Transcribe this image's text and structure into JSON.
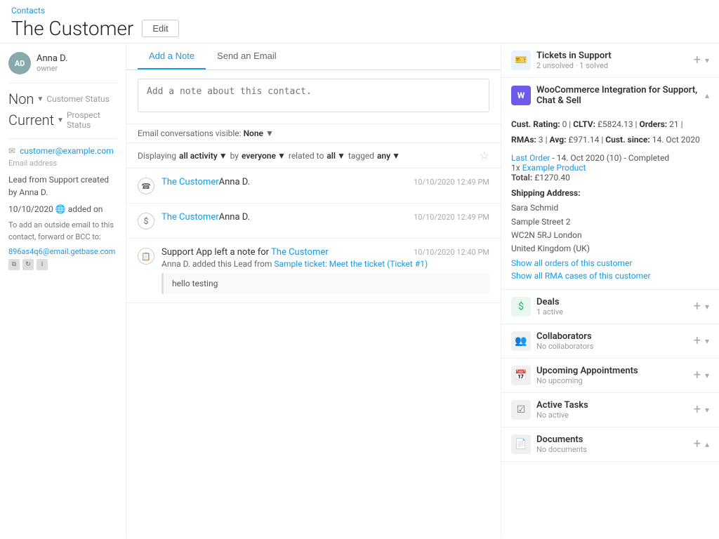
{
  "breadcrumb": "Contacts",
  "page_title": "The Customer",
  "edit_button": "Edit",
  "owner": {
    "initials": "AD",
    "name": "Anna D.",
    "role": "owner"
  },
  "status": {
    "non_label": "Non",
    "customer_status": "Customer Status",
    "current_label": "Current",
    "prospect_status": "Prospect Status"
  },
  "email": {
    "value": "customer@example.com",
    "label": "Email address"
  },
  "lead_info": "Lead from Support created by Anna D.",
  "date_added": "10/10/2020",
  "date_added_suffix": "added on",
  "bcc_info": "To add an outside email to this contact, forward or BCC to:",
  "bcc_email": "896as4q6@email.getbase.com",
  "tabs": {
    "add_note": "Add a Note",
    "send_email": "Send an Email"
  },
  "note_placeholder": "Add a note about this contact.",
  "filter": {
    "displaying": "Displaying",
    "all_activity": "all activity",
    "by": "by",
    "everyone": "everyone",
    "related_to": "related to",
    "all": "all",
    "tagged": "tagged",
    "any": "any"
  },
  "activities": [
    {
      "icon": "☎",
      "type": "call",
      "who_link": "The Customer",
      "who_name": "Anna D.",
      "time": "10/10/2020 12:49 PM"
    },
    {
      "icon": "$",
      "type": "deal",
      "who_link": "The Customer",
      "who_name": "Anna D.",
      "time": "10/10/2020 12:49 PM"
    },
    {
      "icon": "📋",
      "type": "note",
      "who_name": "Support App left a note for",
      "who_link": "The Customer",
      "time": "10/10/2020 12:40 PM",
      "body": "Anna D. added this Lead from Sample ticket: Meet the ticket (Ticket #1)",
      "note_text": "hello testing"
    }
  ],
  "widgets": {
    "tickets": {
      "title": "Tickets in Support",
      "subtitle": "2 unsolved · 1 solved"
    },
    "woocommerce": {
      "title": "WooCommerce Integration for Support, Chat & Sell",
      "cust_rating": "0",
      "cltv": "£5824.13",
      "orders": "21",
      "rmas": "3",
      "avg": "£971.14",
      "cust_since": "14. Oct 2020",
      "last_order_label": "Last Order",
      "last_order_date": "14. Oct 2020 (10)",
      "last_order_status": "Completed",
      "last_order_qty": "1x",
      "last_order_product": "Example Product",
      "last_order_total_label": "Total:",
      "last_order_total": "£1270.40",
      "shipping_label": "Shipping Address:",
      "shipping_name": "Sara Schmid",
      "shipping_street": "Sample Street 2",
      "shipping_postcode_city": "WC2N 5RJ London",
      "shipping_country": "United Kingdom (UK)",
      "show_orders": "Show all orders of this customer",
      "show_rma": "Show all RMA cases of this customer"
    },
    "deals": {
      "title": "Deals",
      "subtitle": "1 active"
    },
    "collaborators": {
      "title": "Collaborators",
      "subtitle": "No collaborators"
    },
    "appointments": {
      "title": "Upcoming Appointments",
      "subtitle": "No upcoming"
    },
    "tasks": {
      "title": "Active Tasks",
      "subtitle": "No active"
    },
    "documents": {
      "title": "Documents",
      "subtitle": "No documents"
    }
  }
}
